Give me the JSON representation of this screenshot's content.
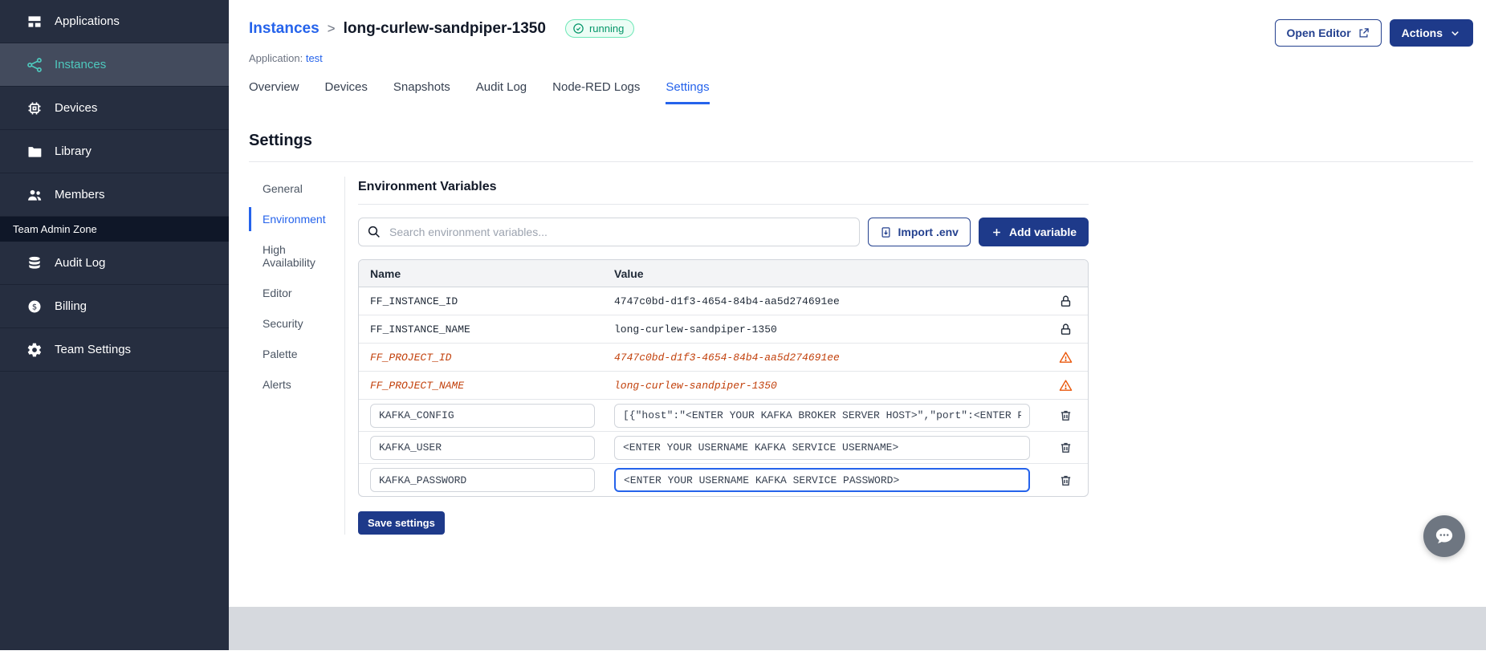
{
  "colors": {
    "sidebar_bg": "#262E40",
    "sidebar_active_bg": "#434B5D",
    "teal_accent": "#4EC9BE",
    "primary_blue": "#1E3A8A",
    "link_blue": "#2563EB",
    "running_green": "#059669",
    "deprecated_orange": "#C2410C",
    "footer_gray": "#D6D9DE"
  },
  "icons": {
    "applications-icon": "grid-collection",
    "instances-icon": "share-nodes",
    "devices-icon": "cpu-chip",
    "library-icon": "folder",
    "members-icon": "users",
    "audit-log-icon": "database-stack",
    "billing-icon": "dollar-circle",
    "team-settings-icon": "gear",
    "running-status-icon": "check-circle",
    "open-editor-icon": "external-link",
    "actions-chevron-icon": "chevron-down",
    "search-icon": "magnifier",
    "import-env-icon": "document-download",
    "add-variable-icon": "plus",
    "lock-icon": "padlock",
    "warning-icon": "warning-triangle",
    "delete-icon": "trash",
    "chat-icon": "speech-bubble"
  },
  "sidebar": {
    "items": [
      {
        "label": "Applications"
      },
      {
        "label": "Instances"
      },
      {
        "label": "Devices"
      },
      {
        "label": "Library"
      },
      {
        "label": "Members"
      }
    ],
    "section_label": "Team Admin Zone",
    "admin_items": [
      {
        "label": "Audit Log"
      },
      {
        "label": "Billing"
      },
      {
        "label": "Team Settings"
      }
    ]
  },
  "header": {
    "breadcrumb_root": "Instances",
    "breadcrumb_separator": ">",
    "instance_name": "long-curlew-sandpiper-1350",
    "status_label": "running",
    "application_label": "Application:",
    "application_name": "test",
    "open_editor_label": "Open Editor",
    "actions_label": "Actions"
  },
  "tabs": [
    "Overview",
    "Devices",
    "Snapshots",
    "Audit Log",
    "Node-RED Logs",
    "Settings"
  ],
  "settings": {
    "page_title": "Settings",
    "nav": [
      "General",
      "Environment",
      "High Availability",
      "Editor",
      "Security",
      "Palette",
      "Alerts"
    ],
    "active_nav": "Environment",
    "section_title": "Environment Variables",
    "search_placeholder": "Search environment variables...",
    "import_button": "Import .env",
    "add_button": "Add variable",
    "table_headers": {
      "name": "Name",
      "value": "Value"
    },
    "rows": [
      {
        "name": "FF_INSTANCE_ID",
        "value": "4747c0bd-d1f3-4654-84b4-aa5d274691ee",
        "type": "locked"
      },
      {
        "name": "FF_INSTANCE_NAME",
        "value": "long-curlew-sandpiper-1350",
        "type": "locked"
      },
      {
        "name": "FF_PROJECT_ID",
        "value": "4747c0bd-d1f3-4654-84b4-aa5d274691ee",
        "type": "deprecated"
      },
      {
        "name": "FF_PROJECT_NAME",
        "value": "long-curlew-sandpiper-1350",
        "type": "deprecated"
      },
      {
        "name": "KAFKA_CONFIG",
        "value": "[{\"host\":\"<ENTER YOUR KAFKA BROKER SERVER HOST>\",\"port\":<ENTER PORT>}]",
        "type": "editable"
      },
      {
        "name": "KAFKA_USER",
        "value": "<ENTER YOUR USERNAME KAFKA SERVICE USERNAME>",
        "type": "editable"
      },
      {
        "name": "KAFKA_PASSWORD",
        "value": "<ENTER YOUR USERNAME KAFKA SERVICE PASSWORD>",
        "type": "editable",
        "focused": true
      }
    ],
    "save_button": "Save settings"
  }
}
